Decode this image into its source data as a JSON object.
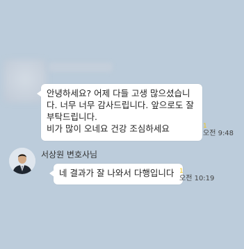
{
  "messages": [
    {
      "sender": "",
      "text": "안녕하세요? 어제 다들 고생 많으셨습니다. 너무 너무 감사드립니다.  앞으로도 잘부탁드립니다.\n비가 많이 오네요 건강 조심하세요",
      "unread": "1",
      "time": "오전 9:48"
    },
    {
      "sender": "서상원 변호사님",
      "text": "네 결과가 잘 나와서 다행입니다",
      "unread": "1",
      "time": "오전 10:19"
    }
  ],
  "colors": {
    "background": "#bcccdb",
    "bubble": "#ffffff",
    "unread": "#f2c51b"
  },
  "icons": {
    "avatar": "profile-photo-icon"
  }
}
